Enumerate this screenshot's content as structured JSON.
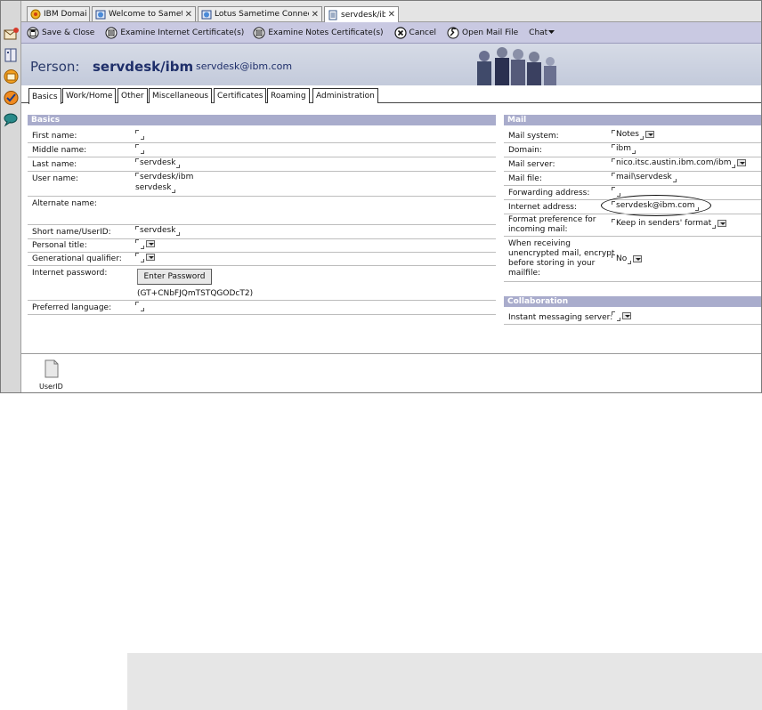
{
  "window_tabs": [
    {
      "label": "IBM Domain",
      "icon": "domino-icon",
      "closable": false,
      "active": false
    },
    {
      "label": "Welcome to Sametime",
      "icon": "web-icon",
      "closable": true,
      "active": false
    },
    {
      "label": "Lotus Sametime Connect - ...",
      "icon": "web-icon",
      "closable": true,
      "active": false
    },
    {
      "label": "servdesk/ibm",
      "icon": "document-icon",
      "closable": true,
      "active": true
    }
  ],
  "actions": {
    "save_close": "Save & Close",
    "examine_internet_cert": "Examine Internet Certificate(s)",
    "examine_notes_cert": "Examine Notes Certificate(s)",
    "cancel": "Cancel",
    "open_mail_file": "Open Mail File",
    "chat": "Chat"
  },
  "header": {
    "type_label": "Person:",
    "name": "servdesk/ibm",
    "email": "servdesk@ibm.com"
  },
  "form_tabs": [
    "Basics",
    "Work/Home",
    "Other",
    "Miscellaneous",
    "Certificates",
    "Roaming",
    "Administration"
  ],
  "basics": {
    "title": "Basics",
    "first_name_label": "First name:",
    "first_name_value": "",
    "middle_name_label": "Middle name:",
    "middle_name_value": "",
    "last_name_label": "Last name:",
    "last_name_value": "servdesk",
    "user_name_label": "User name:",
    "user_name_line1": "servdesk/ibm",
    "user_name_line2": "servdesk",
    "alternate_name_label": "Alternate name:",
    "short_name_label": "Short name/UserID:",
    "short_name_value": "servdesk",
    "personal_title_label": "Personal title:",
    "generational_label": "Generational qualifier:",
    "internet_password_label": "Internet password:",
    "enter_password_button": "Enter Password",
    "password_hash": "(GT+CNbFJQmTSTQGODcT2)",
    "preferred_language_label": "Preferred language:"
  },
  "mail": {
    "title": "Mail",
    "mail_system_label": "Mail system:",
    "mail_system_value": "Notes",
    "domain_label": "Domain:",
    "domain_value": "ibm",
    "mail_server_label": "Mail server:",
    "mail_server_value": "nico.itsc.austin.ibm.com/ibm",
    "mail_file_label": "Mail file:",
    "mail_file_value": "mail\\servdesk",
    "forwarding_label": "Forwarding address:",
    "internet_address_label": "Internet address:",
    "internet_address_value": "servdesk@ibm.com",
    "format_pref_label_1": "Format preference for",
    "format_pref_label_2": "incoming mail:",
    "format_pref_value": "Keep in senders' format",
    "encrypt_label_1": "When receiving",
    "encrypt_label_2": "unencrypted mail, encrypt",
    "encrypt_label_3": "before storing in your",
    "encrypt_label_4": "mailfile:",
    "encrypt_value": "No"
  },
  "collaboration": {
    "title": "Collaboration",
    "im_server_label": "Instant messaging server:"
  },
  "attachment": {
    "label": "UserID"
  },
  "colors": {
    "section_header": "#a9accc",
    "action_bar": "#c9c9e2",
    "title_text": "#1f2f6a"
  }
}
